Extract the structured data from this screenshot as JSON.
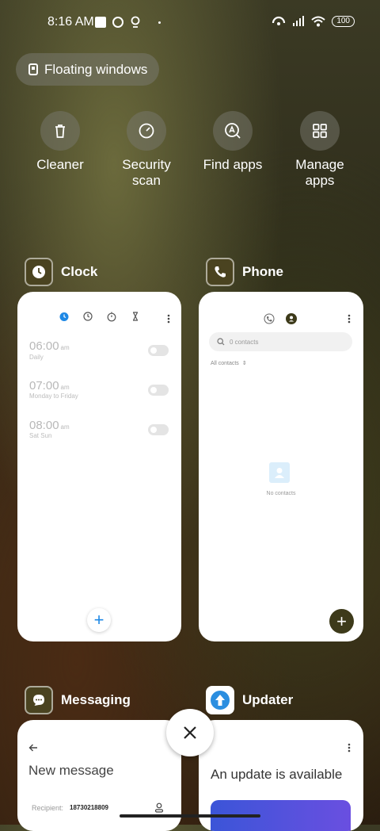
{
  "status_bar": {
    "time": "8:16 AM",
    "battery": "100"
  },
  "floating_windows": {
    "label": "Floating windows"
  },
  "quick_actions": [
    {
      "label": "Cleaner",
      "icon": "trash-icon"
    },
    {
      "label": "Security\nscan",
      "icon": "scan-icon"
    },
    {
      "label": "Find apps",
      "icon": "find-apps-icon"
    },
    {
      "label": "Manage\napps",
      "icon": "grid-icon"
    }
  ],
  "apps": {
    "clock": {
      "name": "Clock",
      "alarms": [
        {
          "time": "06:00",
          "ampm": "am",
          "repeat": "Daily"
        },
        {
          "time": "07:00",
          "ampm": "am",
          "repeat": "Monday to Friday"
        },
        {
          "time": "08:00",
          "ampm": "am",
          "repeat": "Sat Sun"
        }
      ],
      "add_label": "+"
    },
    "phone": {
      "name": "Phone",
      "search_placeholder": "0 contacts",
      "filter_label": "All contacts",
      "empty_label": "No contacts",
      "add_label": "+"
    },
    "messaging": {
      "name": "Messaging",
      "title": "New message",
      "recipient_label": "Recipient:",
      "recipient_value": "18730218809"
    },
    "updater": {
      "name": "Updater",
      "title": "An update is available"
    }
  },
  "colors": {
    "accent_blue": "#1e88e5",
    "olive_fab": "#3d3a1a",
    "card_bg": "#ffffff"
  }
}
